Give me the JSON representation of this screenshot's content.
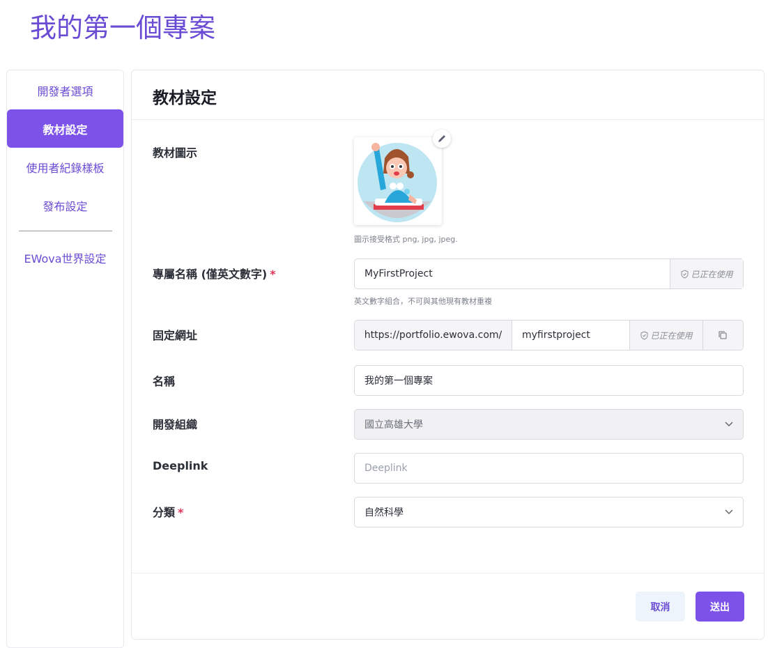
{
  "page": {
    "title": "我的第一個專案"
  },
  "sidebar": {
    "items": [
      {
        "label": "開發者選項"
      },
      {
        "label": "教材設定"
      },
      {
        "label": "使用者紀錄樣板"
      },
      {
        "label": "發布設定"
      },
      {
        "label": "EWova世界設定"
      }
    ],
    "active_index": 1
  },
  "card": {
    "title": "教材設定"
  },
  "form": {
    "icon": {
      "label": "教材圖示",
      "hint": "圖示接受格式 png, jpg, jpeg."
    },
    "slug": {
      "label": "專屬名稱 (僅英文數字)",
      "required_mark": "*",
      "value": "MyFirstProject",
      "status": "已正在使用",
      "hint": "英文數字組合，不可與其他現有教材重複"
    },
    "url": {
      "label": "固定網址",
      "prefix": "https://portfolio.ewova.com/",
      "value": "myfirstproject",
      "status": "已正在使用"
    },
    "name": {
      "label": "名稱",
      "value": "我的第一個專案"
    },
    "org": {
      "label": "開發組織",
      "value": "國立高雄大學"
    },
    "deeplink": {
      "label": "Deeplink",
      "placeholder": "Deeplink"
    },
    "category": {
      "label": "分類",
      "required_mark": "*",
      "value": "自然科學"
    }
  },
  "buttons": {
    "cancel": "取消",
    "submit": "送出"
  },
  "colors": {
    "accent": "#7c52e8",
    "title": "#6a4bd4",
    "required": "#e0335a"
  }
}
